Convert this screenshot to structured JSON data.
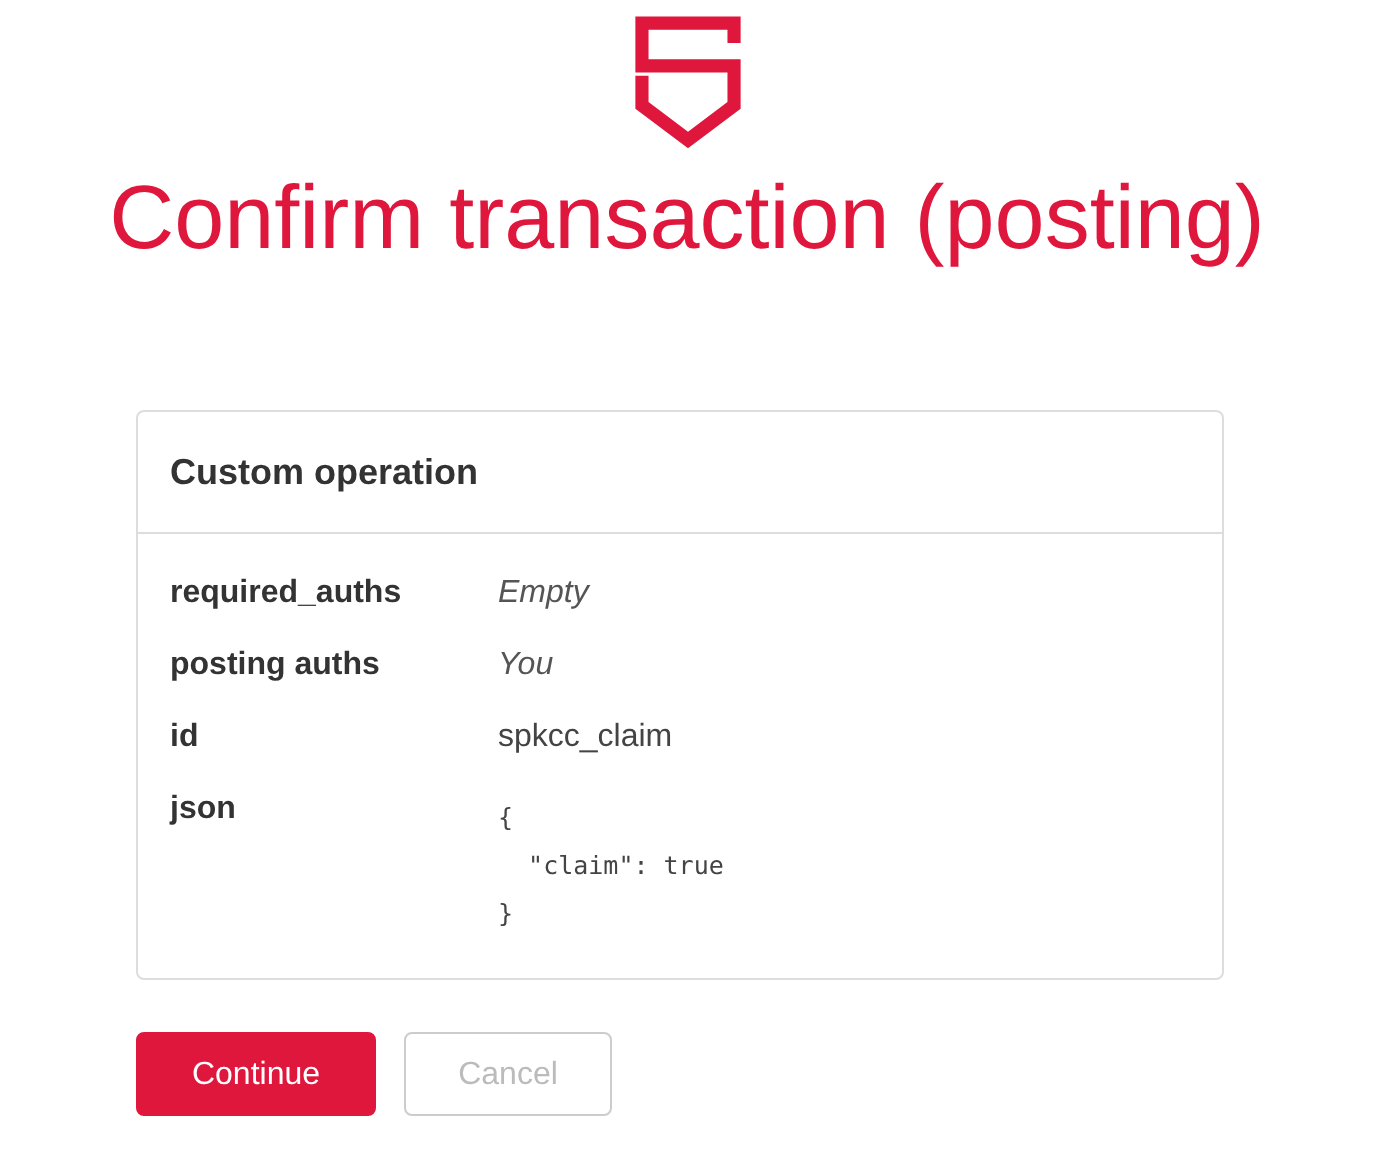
{
  "title": "Confirm transaction (posting)",
  "operation": {
    "heading": "Custom operation",
    "fields": [
      {
        "label": "required_auths",
        "kind": "italic",
        "value": "Empty"
      },
      {
        "label": "posting auths",
        "kind": "italic",
        "value": "You"
      },
      {
        "label": "id",
        "kind": "text",
        "value": "spkcc_claim"
      },
      {
        "label": "json",
        "kind": "code",
        "value": "{\n  \"claim\": true\n}"
      }
    ]
  },
  "buttons": [
    {
      "label": "Continue",
      "kind": "primary"
    },
    {
      "label": "Cancel",
      "kind": "secondary"
    }
  ]
}
